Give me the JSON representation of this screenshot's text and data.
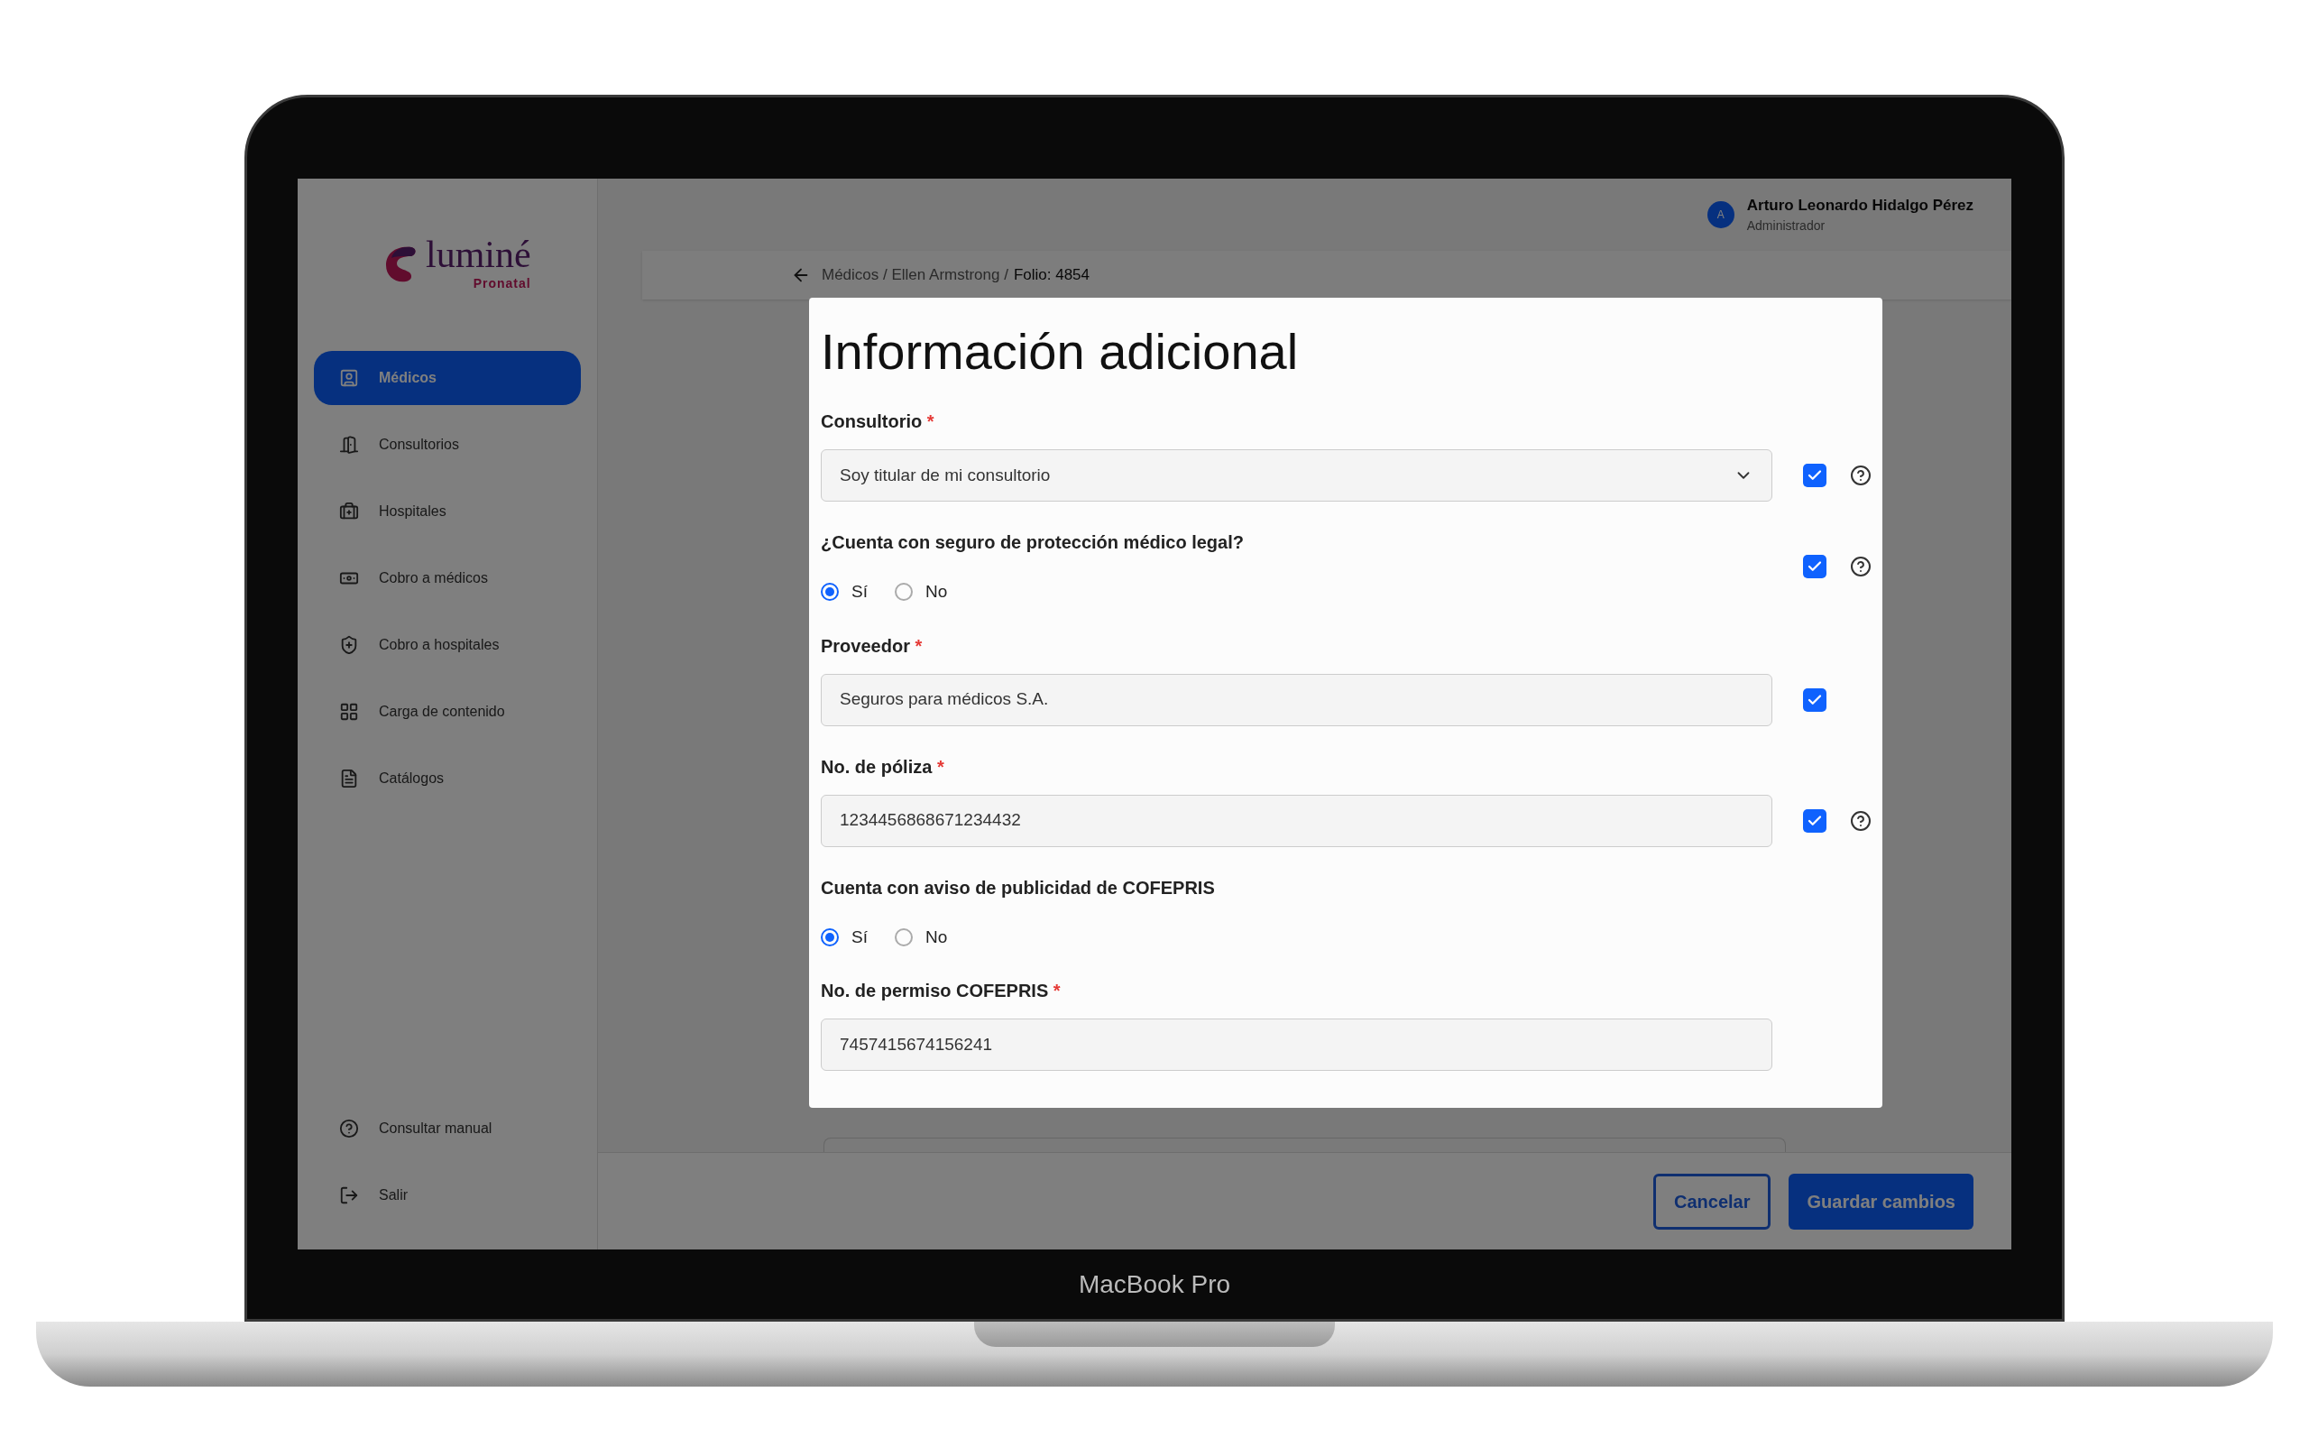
{
  "device": {
    "label": "MacBook Pro"
  },
  "sidebar": {
    "logo": {
      "wordmark": "luminé",
      "tagline": "Pronatal"
    },
    "items": [
      {
        "label": "Médicos",
        "selected": true
      },
      {
        "label": "Consultorios",
        "selected": false
      },
      {
        "label": "Hospitales",
        "selected": false
      },
      {
        "label": "Cobro a médicos",
        "selected": false
      },
      {
        "label": "Cobro a hospitales",
        "selected": false
      },
      {
        "label": "Carga de contenido",
        "selected": false
      },
      {
        "label": "Catálogos",
        "selected": false
      }
    ],
    "footer_items": [
      {
        "label": "Consultar manual"
      },
      {
        "label": "Salir"
      }
    ]
  },
  "header": {
    "user": {
      "initial": "A",
      "name": "Arturo Leonardo Hidalgo Pérez",
      "role": "Administrador"
    }
  },
  "breadcrumb": {
    "path": "Médicos / Ellen Armstrong /",
    "current": "Folio: 4854"
  },
  "modal": {
    "title": "Información adicional",
    "fields": [
      {
        "kind": "select",
        "label": "Consultorio",
        "required_mark": "*",
        "value": "Soy titular de mi consultorio",
        "checkbox": {
          "checked": true
        },
        "help": true
      },
      {
        "kind": "radio",
        "label": "¿Cuenta con seguro de protección médico legal?",
        "options": [
          {
            "label": "Sí",
            "selected": true
          },
          {
            "label": "No",
            "selected": false
          }
        ],
        "checkbox": {
          "checked": true
        },
        "help": true
      },
      {
        "kind": "text",
        "label": "Proveedor",
        "required_mark": "*",
        "value": "Seguros para médicos S.A.",
        "checkbox": {
          "checked": true
        },
        "help": false
      },
      {
        "kind": "text",
        "label": "No. de póliza",
        "required_mark": "*",
        "value": "1234456868671234432",
        "checkbox": {
          "checked": true
        },
        "help": true
      },
      {
        "kind": "radio",
        "label": "Cuenta con aviso de publicidad de COFEPRIS",
        "options": [
          {
            "label": "Sí",
            "selected": true
          },
          {
            "label": "No",
            "selected": false
          }
        ],
        "help": false
      },
      {
        "kind": "text",
        "label": "No. de permiso COFEPRIS",
        "required_mark": "*",
        "value": "7457415674156241",
        "help": false
      }
    ]
  },
  "footer": {
    "buttons": [
      {
        "label": "Cancelar",
        "kind": "secondary"
      },
      {
        "label": "Guardar cambios",
        "kind": "primary"
      }
    ]
  }
}
